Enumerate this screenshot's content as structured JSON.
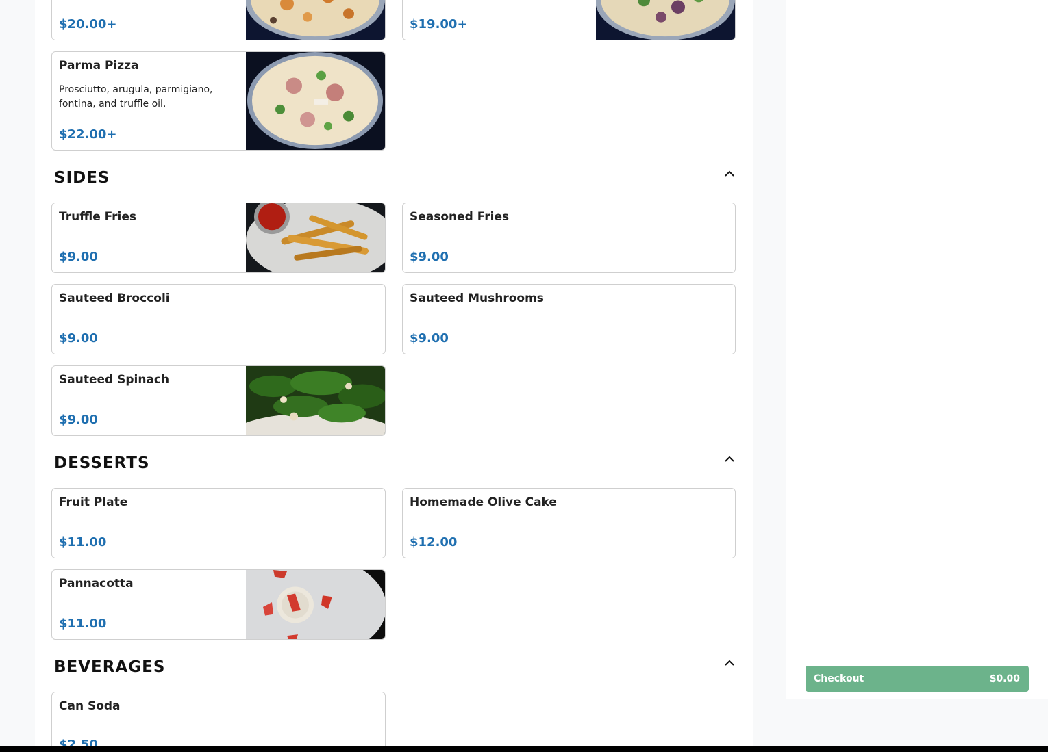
{
  "pizza": {
    "items": [
      {
        "price": "$20.00+"
      },
      {
        "price": "$19.00+"
      },
      {
        "name": "Parma Pizza",
        "description": "Prosciutto, arugula, parmigiano, fontina, and truffle oil.",
        "price": "$22.00+"
      }
    ]
  },
  "sides": {
    "title": "SIDES",
    "items": [
      {
        "name": "Truffle Fries",
        "price": "$9.00"
      },
      {
        "name": "Seasoned Fries",
        "price": "$9.00"
      },
      {
        "name": "Sauteed Broccoli",
        "price": "$9.00"
      },
      {
        "name": "Sauteed Mushrooms",
        "price": "$9.00"
      },
      {
        "name": "Sauteed Spinach",
        "price": "$9.00"
      }
    ]
  },
  "desserts": {
    "title": "DESSERTS",
    "items": [
      {
        "name": "Fruit Plate",
        "price": "$11.00"
      },
      {
        "name": "Homemade Olive Cake",
        "price": "$12.00"
      },
      {
        "name": "Pannacotta",
        "price": "$11.00"
      }
    ]
  },
  "beverages": {
    "title": "BEVERAGES",
    "items": [
      {
        "name": "Can Soda",
        "price": "$2.50"
      }
    ]
  },
  "cart": {
    "checkout_label": "Checkout",
    "total": "$0.00"
  },
  "colors": {
    "price": "#1f6fb0",
    "checkout_bg": "#6cb38b"
  }
}
